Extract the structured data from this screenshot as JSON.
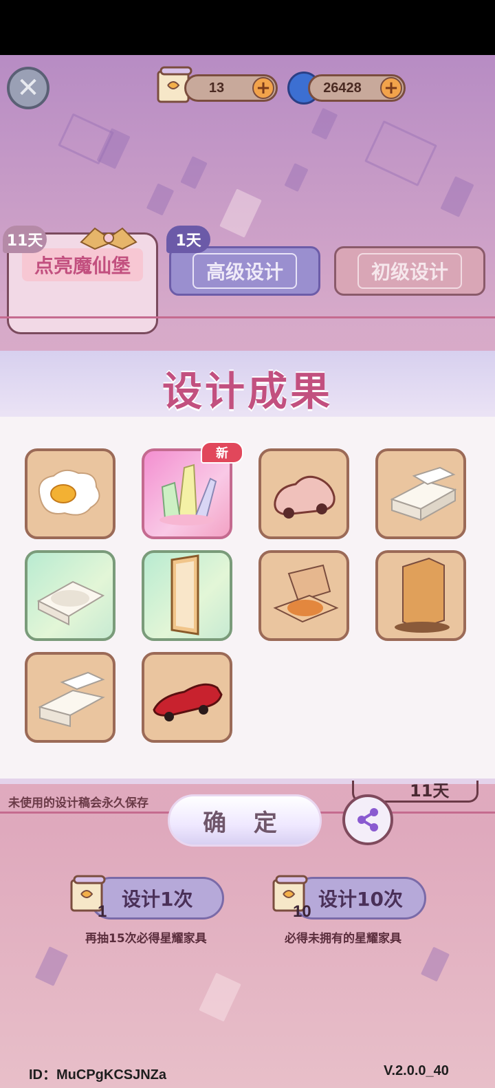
{
  "topbar": {
    "close_icon": "close-icon",
    "design_ticket_count": "13",
    "currency_count": "26428",
    "plus_label": "+"
  },
  "tabs": [
    {
      "label": "点亮魔仙堡",
      "badge": "11天"
    },
    {
      "label": "高级设计",
      "badge": "1天"
    },
    {
      "label": "初级设计"
    }
  ],
  "results": {
    "title": "设计成果",
    "new_badge": "新",
    "items": [
      {
        "name": "fried-egg"
      },
      {
        "name": "crystal-cluster",
        "is_new": true
      },
      {
        "name": "pink-car"
      },
      {
        "name": "bathroom-sink"
      },
      {
        "name": "bathtub"
      },
      {
        "name": "mirror-door"
      },
      {
        "name": "pizza-box"
      },
      {
        "name": "wooden-cabinet"
      },
      {
        "name": "counter-sink"
      },
      {
        "name": "red-sports-car"
      }
    ]
  },
  "bottom": {
    "note": "未使用的设计稿会永久保存",
    "confirm_label": "确 定",
    "timer": "11天",
    "draw_once": {
      "label": "设计1次",
      "count": "1",
      "hint": "再抽15次必得星耀家具"
    },
    "draw_ten": {
      "label": "设计10次",
      "count": "10",
      "hint": "必得未拥有的星耀家具"
    }
  },
  "footer": {
    "id": "ID：MuCPgKCSJNZa",
    "version": "V.2.0.0_40"
  },
  "colors": {
    "accent": "#c2507f",
    "confirm_text": "#6f566a",
    "new_badge": "#e1475b"
  }
}
